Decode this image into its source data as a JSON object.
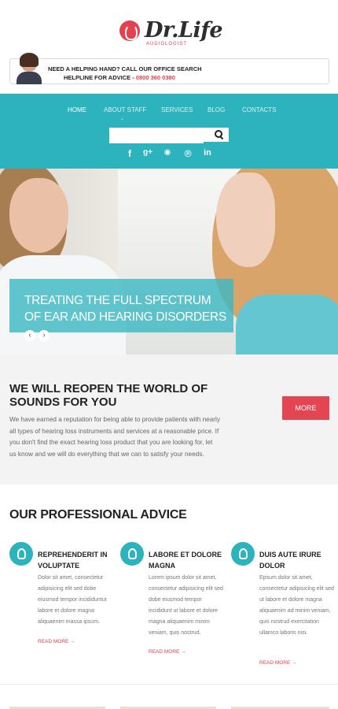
{
  "brand": {
    "name": "Dr.Life",
    "tagline": "AUDIOLOGIST"
  },
  "helpbar": {
    "line1": "NEED A HELPING HAND? CALL OUR OFFICE SEARCH",
    "line2_prefix": "HELPLINE FOR ADVICE - ",
    "phone": "0800 360 0380"
  },
  "nav": {
    "items": [
      {
        "label": "HOME",
        "active": true
      },
      {
        "label": "ABOUT STAFF",
        "active": false
      },
      {
        "label": "SERVICES",
        "active": false
      },
      {
        "label": "BLOG",
        "active": false
      },
      {
        "label": "CONTACTS",
        "active": false
      }
    ],
    "submenu_caret": "⌄",
    "search_placeholder": "",
    "social": [
      {
        "icon": "facebook-icon",
        "glyph": "f"
      },
      {
        "icon": "google-plus-icon",
        "glyph": "g+"
      },
      {
        "icon": "rss-icon",
        "glyph": "◉"
      },
      {
        "icon": "pinterest-icon",
        "glyph": "℗"
      },
      {
        "icon": "linkedin-icon",
        "glyph": "in"
      }
    ]
  },
  "hero": {
    "title_line1": "TREATING THE FULL SPECTRUM",
    "title_line2": "OF EAR AND HEARING DISORDERS",
    "prev": "‹",
    "next": "›"
  },
  "intro": {
    "title": "WE WILL REOPEN THE WORLD OF SOUNDS FOR YOU",
    "text": "We have earned a reputation for being able to provide patients with nearly all types of hearing loss instruments and services at a reasonable price. If you don't find the exact hearing loss product that you are looking for, let us know and we will do everything that we can to satisfy your needs.",
    "button": "MORE"
  },
  "advice": {
    "title": "OUR PROFESSIONAL ADVICE",
    "columns": [
      {
        "title": "REPREHENDERIT IN VOLUPTATE",
        "text": "Dolor sit amet, consectetur adipisicing elit sed dobe eiusmod tempor incididuntut labore et dolore magna aliquaenim massa ipsum.",
        "link": "READ MORE →"
      },
      {
        "title": "LABORE ET DOLORE MAGNA",
        "text": "Lorem ipsum dolor sit amet, consectetur adipisicing elit sed dobe eiusmod tempor incididunt ut labore et dolore magna aliquaenim minim veniam, quis nostrud.",
        "link": "READ MORE →"
      },
      {
        "title": "DUIS AUTE IRURE DOLOR",
        "text": "Epsum dolor sit amet, consectetur adipisicing elit sed ut labore et dolore magna aliquaenim ad minim veniam, quis nostrud exercitation ullamco laboris nisi.",
        "link": "READ MORE →"
      }
    ]
  },
  "colors": {
    "teal": "#2db3bd",
    "red": "#e4404f",
    "band": "#f3f3f3"
  }
}
